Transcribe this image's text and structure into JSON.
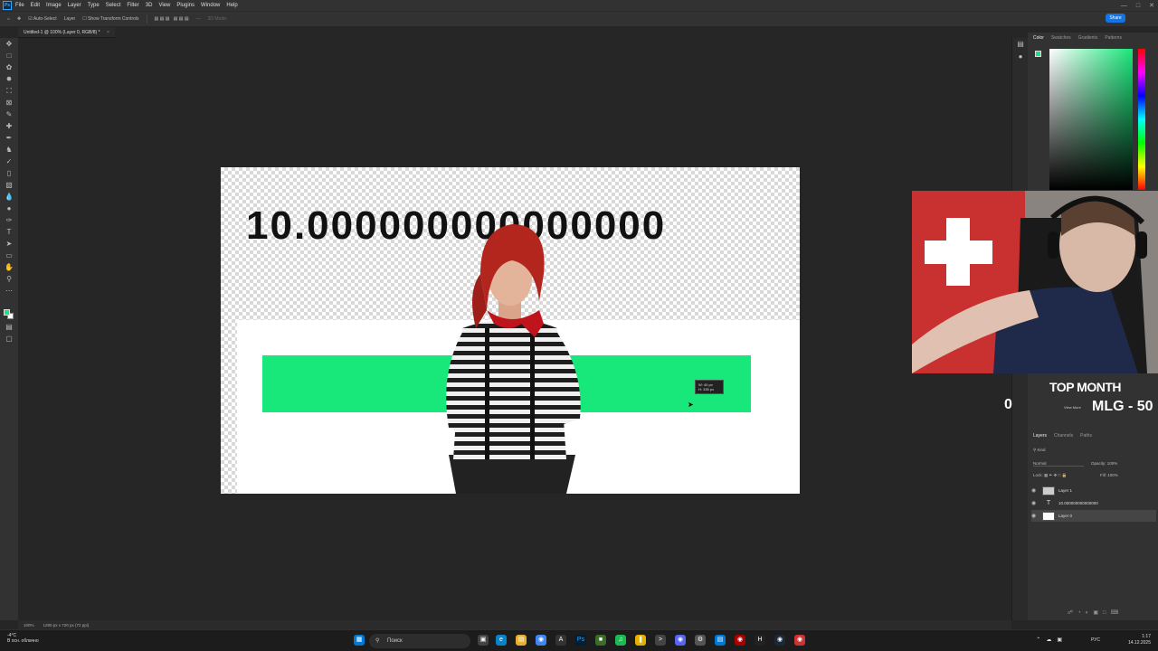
{
  "menu": {
    "app_logo": "Ps",
    "items": [
      "File",
      "Edit",
      "Image",
      "Layer",
      "Type",
      "Select",
      "Filter",
      "3D",
      "View",
      "Plugins",
      "Window",
      "Help"
    ],
    "window_controls": [
      "—",
      "□",
      "✕"
    ]
  },
  "options_bar": {
    "auto_select": "Auto-Select",
    "layer_dropdown": "Layer",
    "transform_controls": "Show Transform Controls",
    "mode_3d": "3D Mode:",
    "share": "Share"
  },
  "document": {
    "tab_title": "Untitled-1 @ 100% (Layer 0, RGB/8) *"
  },
  "canvas": {
    "big_number": "10.000000000000000",
    "green_bar_color": "#18e87a",
    "measure_tip_line1": "W: 40 px",
    "measure_tip_line2": "H: 335 px"
  },
  "color_panel": {
    "tabs": [
      "Color",
      "Swatches",
      "Gradients",
      "Patterns"
    ],
    "foreground": "#19e67a",
    "background": "#ffffff"
  },
  "stream_overlay": {
    "title": "TOP MONTH",
    "subtitle": "MLG - 50",
    "counter": "0",
    "tiny_label": "View More"
  },
  "layers_panel": {
    "tabs": [
      "Layers",
      "Channels",
      "Paths"
    ],
    "kind_filter": "Kind",
    "blend_mode": "Normal",
    "opacity_label": "Opacity:",
    "opacity_value": "100%",
    "lock_label": "Lock:",
    "fill_label": "Fill:",
    "fill_value": "100%",
    "layers": [
      {
        "name": "Layer 1",
        "type": "image"
      },
      {
        "name": "10.000000000000000",
        "type": "text"
      },
      {
        "name": "Layer 0",
        "type": "image"
      }
    ]
  },
  "status_bar": {
    "zoom": "100%",
    "doc_size": "1280 px x 720 px (72 ppi)"
  },
  "taskbar": {
    "weather_temp": "-4°C",
    "weather_desc": "В осн. облачно",
    "search_placeholder": "Поиск",
    "language": "РУС",
    "time": "1:17",
    "date": "14.12.2025"
  }
}
